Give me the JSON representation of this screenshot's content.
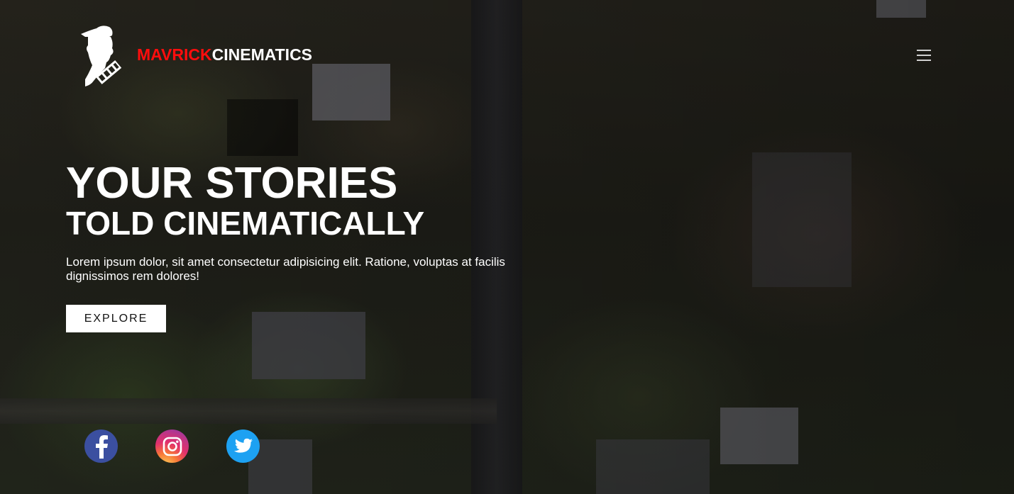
{
  "brand": {
    "name_part1": "MAVRICK",
    "name_part2": "CINEMATICS",
    "accent_color": "#ff0d0d"
  },
  "header": {
    "menu_icon": "hamburger-menu-icon"
  },
  "hero": {
    "title_line1": "YOUR STORIES",
    "title_line2": "TOLD CINEMATICALLY",
    "description": "Lorem ipsum dolor, sit amet consectetur adipisicing elit. Ratione, voluptas at facilis dignissimos rem dolores!",
    "cta_label": "EXPLORE"
  },
  "social": [
    {
      "icon": "facebook-icon",
      "color": "#3b4fa0"
    },
    {
      "icon": "instagram-icon",
      "color": "#e1306c"
    },
    {
      "icon": "twitter-icon",
      "color": "#1da1f2"
    }
  ]
}
